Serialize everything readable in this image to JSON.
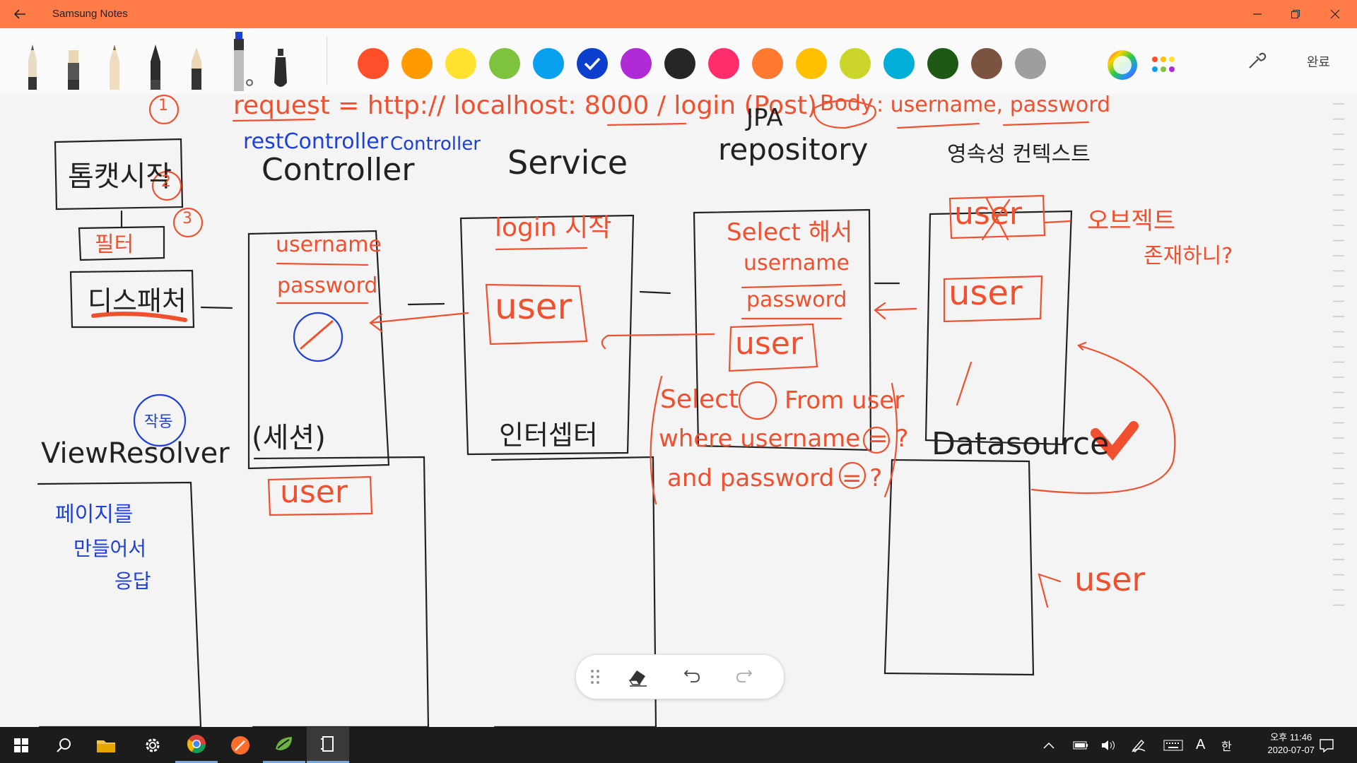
{
  "window": {
    "title": "Samsung Notes"
  },
  "toolbar": {
    "done_label": "완료",
    "pens": [
      "pen-cream",
      "marker-beige",
      "pencil-tan",
      "fountain-black",
      "brush-dark",
      "highlighter-gray",
      "calligraphy-black"
    ],
    "colors": [
      "#ff4e2a",
      "#ff9a00",
      "#ffe22f",
      "#7ec23e",
      "#0aa0f0",
      "#0d3fcf",
      "#b02bd6",
      "#262626",
      "#ff2d6b",
      "#ff7a30",
      "#ffc000",
      "#ccd62a",
      "#00aed8",
      "#1e5a16",
      "#7b5340",
      "#9e9e9e"
    ],
    "selected_color_index": 5
  },
  "note": {
    "request_line": "request = http:// localhost: 8000 / login (Post)",
    "body_tag": "Body",
    "body_params": ": username, password",
    "steps": [
      {
        "num": "1",
        "label": "톰캣시작"
      },
      {
        "num": "2",
        "label": "필터"
      },
      {
        "num": "3",
        "label": "디스패처"
      }
    ],
    "rest_controller": "restController",
    "controller_blue": "Controller",
    "controller": "Controller",
    "controller_fields": [
      "username",
      "password"
    ],
    "service": "Service",
    "service_text": "login 시작",
    "jpa": "JPA",
    "repository": "repository",
    "repo_fields": [
      "Select 해서",
      "username",
      "password"
    ],
    "persist": "영속성 컨텍스트",
    "user": "user",
    "object_question": [
      "오브젝트",
      "존재하니?"
    ],
    "query": [
      "Select",
      "From user",
      "where username = ?",
      "and password = ?"
    ],
    "datasource": "Datasource",
    "view_resolver": "ViewResolver",
    "vr_note": "작동",
    "vr_box": [
      "페이지를",
      "만들어서",
      "응답"
    ],
    "session": "(세션)",
    "interceptor": "인터셉터"
  },
  "floatbar": {
    "tools": [
      "drag-handle",
      "eraser",
      "undo",
      "redo"
    ]
  },
  "taskbar": {
    "apps": [
      "start",
      "search",
      "file-explorer",
      "settings",
      "chrome",
      "app-orange",
      "spring-tool",
      "notes"
    ],
    "clock_line1": "오후 11:46",
    "clock_line2": "2020-07-07",
    "ime_a": "A",
    "ime_han": "한"
  }
}
